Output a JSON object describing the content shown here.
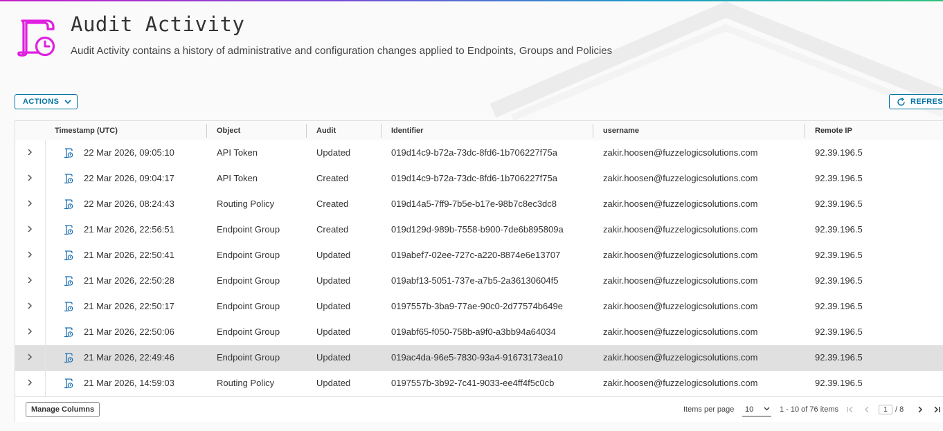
{
  "header": {
    "title": "Audit Activity",
    "subtitle": "Audit Activity contains a history of administrative and configuration changes applied to Endpoints, Groups and Policies",
    "icon": "audit-clipboard-clock-icon",
    "icon_color": "#e020e0"
  },
  "toolbar": {
    "actions_label": "ACTIONS",
    "refresh_label": "REFRESH"
  },
  "grid": {
    "columns": [
      "Timestamp (UTC)",
      "Object",
      "Audit",
      "Identifier",
      "username",
      "Remote IP"
    ],
    "rows": [
      {
        "timestamp": "22 Mar 2026, 09:05:10",
        "object": "API Token",
        "audit": "Updated",
        "identifier": "019d14c9-b72a-73dc-8fd6-1b706227f75a",
        "username": "zakir.hoosen@fuzzelogicsolutions.com",
        "ip": "92.39.196.5"
      },
      {
        "timestamp": "22 Mar 2026, 09:04:17",
        "object": "API Token",
        "audit": "Created",
        "identifier": "019d14c9-b72a-73dc-8fd6-1b706227f75a",
        "username": "zakir.hoosen@fuzzelogicsolutions.com",
        "ip": "92.39.196.5"
      },
      {
        "timestamp": "22 Mar 2026, 08:24:43",
        "object": "Routing Policy",
        "audit": "Created",
        "identifier": "019d14a5-7ff9-7b5e-b17e-98b7c8ec3dc8",
        "username": "zakir.hoosen@fuzzelogicsolutions.com",
        "ip": "92.39.196.5"
      },
      {
        "timestamp": "21 Mar 2026, 22:56:51",
        "object": "Endpoint Group",
        "audit": "Created",
        "identifier": "019d129d-989b-7558-b900-7de6b895809a",
        "username": "zakir.hoosen@fuzzelogicsolutions.com",
        "ip": "92.39.196.5"
      },
      {
        "timestamp": "21 Mar 2026, 22:50:41",
        "object": "Endpoint Group",
        "audit": "Updated",
        "identifier": "019abef7-02ee-727c-a220-8874e6e13707",
        "username": "zakir.hoosen@fuzzelogicsolutions.com",
        "ip": "92.39.196.5"
      },
      {
        "timestamp": "21 Mar 2026, 22:50:28",
        "object": "Endpoint Group",
        "audit": "Updated",
        "identifier": "019abf13-5051-737e-a7b5-2a36130604f5",
        "username": "zakir.hoosen@fuzzelogicsolutions.com",
        "ip": "92.39.196.5"
      },
      {
        "timestamp": "21 Mar 2026, 22:50:17",
        "object": "Endpoint Group",
        "audit": "Updated",
        "identifier": "0197557b-3ba9-77ae-90c0-2d77574b649e",
        "username": "zakir.hoosen@fuzzelogicsolutions.com",
        "ip": "92.39.196.5"
      },
      {
        "timestamp": "21 Mar 2026, 22:50:06",
        "object": "Endpoint Group",
        "audit": "Updated",
        "identifier": "019abf65-f050-758b-a9f0-a3bb94a64034",
        "username": "zakir.hoosen@fuzzelogicsolutions.com",
        "ip": "92.39.196.5"
      },
      {
        "timestamp": "21 Mar 2026, 22:49:46",
        "object": "Endpoint Group",
        "audit": "Updated",
        "identifier": "019ac4da-96e5-7830-93a4-91673173ea10",
        "username": "zakir.hoosen@fuzzelogicsolutions.com",
        "ip": "92.39.196.5",
        "selected": true
      },
      {
        "timestamp": "21 Mar 2026, 14:59:03",
        "object": "Routing Policy",
        "audit": "Updated",
        "identifier": "0197557b-3b92-7c41-9033-ee4ff4f5c0cb",
        "username": "zakir.hoosen@fuzzelogicsolutions.com",
        "ip": "92.39.196.5"
      }
    ]
  },
  "footer": {
    "manage_columns_label": "Manage Columns",
    "items_per_page_label": "Items per page",
    "items_per_page_value": "10",
    "range_text": "1 - 10 of 76 items",
    "current_page": "1",
    "total_pages_text": "/ 8"
  },
  "colors": {
    "accent": "#0072a3",
    "brand_icon": "#e020e0",
    "row_icon": "#1a6fb5",
    "selected_row": "#e0e0e0"
  }
}
